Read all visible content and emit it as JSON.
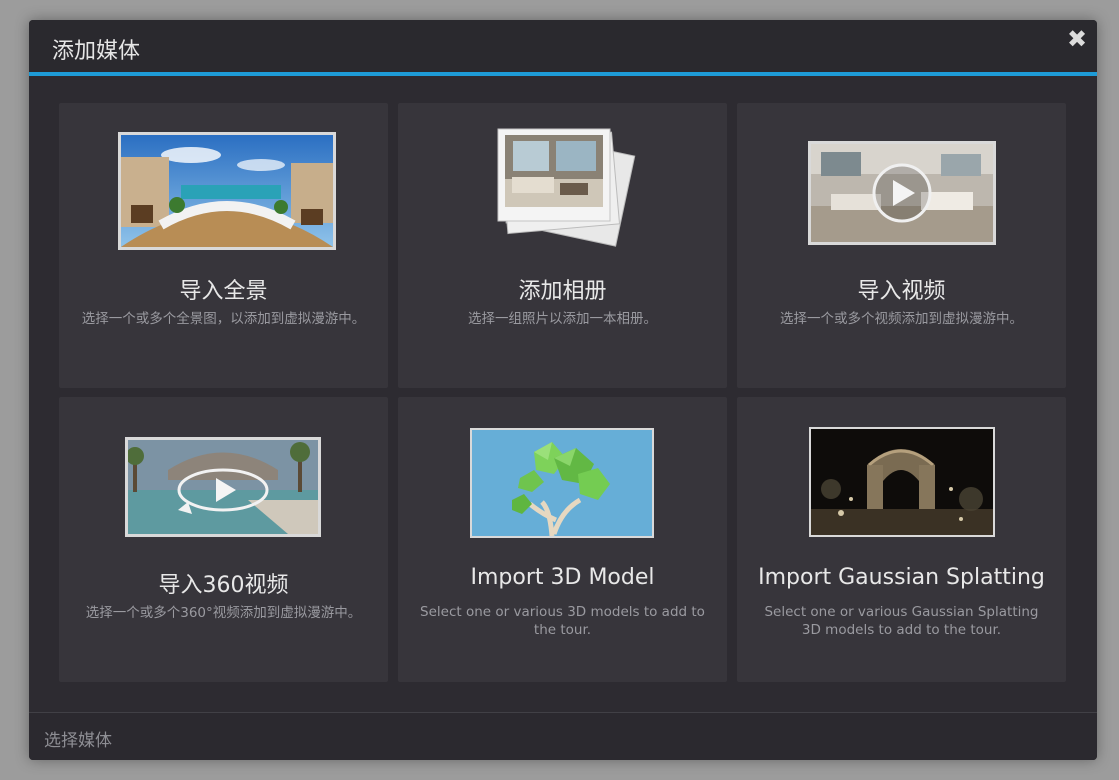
{
  "dialog": {
    "title": "添加媒体",
    "close_glyph": "✖",
    "footer_label": "选择媒体"
  },
  "cards": [
    {
      "title": "导入全景",
      "description": "选择一个或多个全景图，以添加到虚拟漫游中。",
      "icon": "panorama-thumbnail-icon"
    },
    {
      "title": "添加相册",
      "description": "选择一组照片以添加一本相册。",
      "icon": "photo-album-icon"
    },
    {
      "title": "导入视频",
      "description": "选择一个或多个视频添加到虚拟漫游中。",
      "icon": "video-thumbnail-icon"
    },
    {
      "title": "导入360视频",
      "description": "选择一个或多个360°视频添加到虚拟漫游中。",
      "icon": "video-360-icon"
    },
    {
      "title": "Import 3D Model",
      "description": "Select one or various 3D models to add to the tour.",
      "icon": "3d-model-icon"
    },
    {
      "title": "Import Gaussian Splatting",
      "description": "Select one or various Gaussian Splatting 3D models to add to the tour.",
      "icon": "gaussian-splatting-icon"
    }
  ],
  "colors": {
    "accent": "#1e9bd7",
    "dialog_bg": "#2d2b31",
    "card_bg": "#37353b"
  }
}
